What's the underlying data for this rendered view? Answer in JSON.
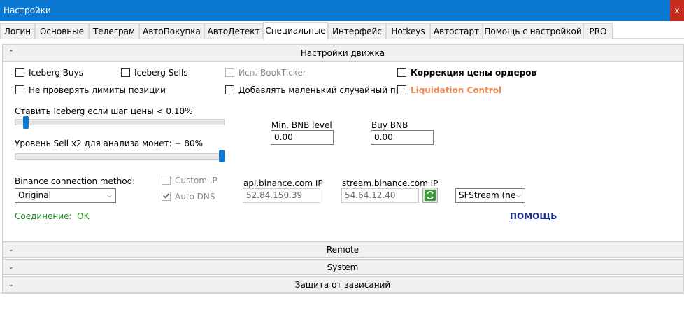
{
  "window": {
    "title": "Настройки",
    "close_label": "x"
  },
  "tabs": [
    {
      "label": "Логин"
    },
    {
      "label": "Основные"
    },
    {
      "label": "Телеграм"
    },
    {
      "label": "АвтоПокупка"
    },
    {
      "label": "АвтоДетект"
    },
    {
      "label": "Специальные"
    },
    {
      "label": "Интерфейс"
    },
    {
      "label": "Hotkeys"
    },
    {
      "label": "Автостарт"
    },
    {
      "label": "Помощь с настройкой"
    },
    {
      "label": "PRO"
    }
  ],
  "active_tab": "Специальные",
  "engine_section": {
    "title": "Настройки движка",
    "checkboxes": {
      "iceberg_buys": {
        "label": "Iceberg Buys",
        "checked": false
      },
      "iceberg_sells": {
        "label": "Iceberg Sells",
        "checked": false
      },
      "use_bookticker": {
        "label": "Исп. BookTicker",
        "checked": false,
        "disabled": true
      },
      "order_price_correction": {
        "label": "Коррекция цены ордеров",
        "checked": false
      },
      "no_position_limits": {
        "label": "Не проверять лимиты позиции",
        "checked": false
      },
      "add_random_percent": {
        "label": "Добавлять маленький случайный проце",
        "checked": false
      },
      "liquidation_control": {
        "label": "Liquidation Control",
        "checked": false
      }
    },
    "iceberg_slider": {
      "label": "Ставить Iceberg если шаг цены < 0.10%",
      "level": 0.04
    },
    "sell_x2_slider": {
      "label": "Уровень Sell x2 для анализа монет: + 80%",
      "level": 1.0
    },
    "min_bnb": {
      "label": "Min. BNB level",
      "value": "0.00"
    },
    "buy_bnb": {
      "label": "Buy BNB",
      "value": "0.00"
    },
    "connection_method": {
      "label": "Binance connection method:",
      "value": "Original"
    },
    "custom_ip": {
      "label": "Custom IP",
      "checked": false,
      "disabled": true
    },
    "auto_dns": {
      "label": "Auto DNS",
      "checked": true,
      "disabled": true
    },
    "api_ip": {
      "label": "api.binance.com IP",
      "value": "52.84.150.39"
    },
    "stream_ip": {
      "label": "stream.binance.com IP",
      "value": "54.64.12.40"
    },
    "stream_mode": {
      "value": "SFStream (nev"
    },
    "connection_status": {
      "label": "Соединение:",
      "value": "OK"
    },
    "help_link": "ПОМОЩЬ"
  },
  "collapsed_sections": [
    {
      "title": "Remote"
    },
    {
      "title": "System"
    },
    {
      "title": "Защита от зависаний"
    }
  ],
  "colors": {
    "titlebar": "#0b78d4",
    "close": "#c42b1c",
    "liquidation": "#f08a54",
    "status_ok": "#1a8a1a",
    "help_link": "#1a2f8a"
  },
  "icons": {
    "refresh": "refresh-icon",
    "expand": "chevron-up-icon",
    "collapse": "chevron-down-icon"
  }
}
